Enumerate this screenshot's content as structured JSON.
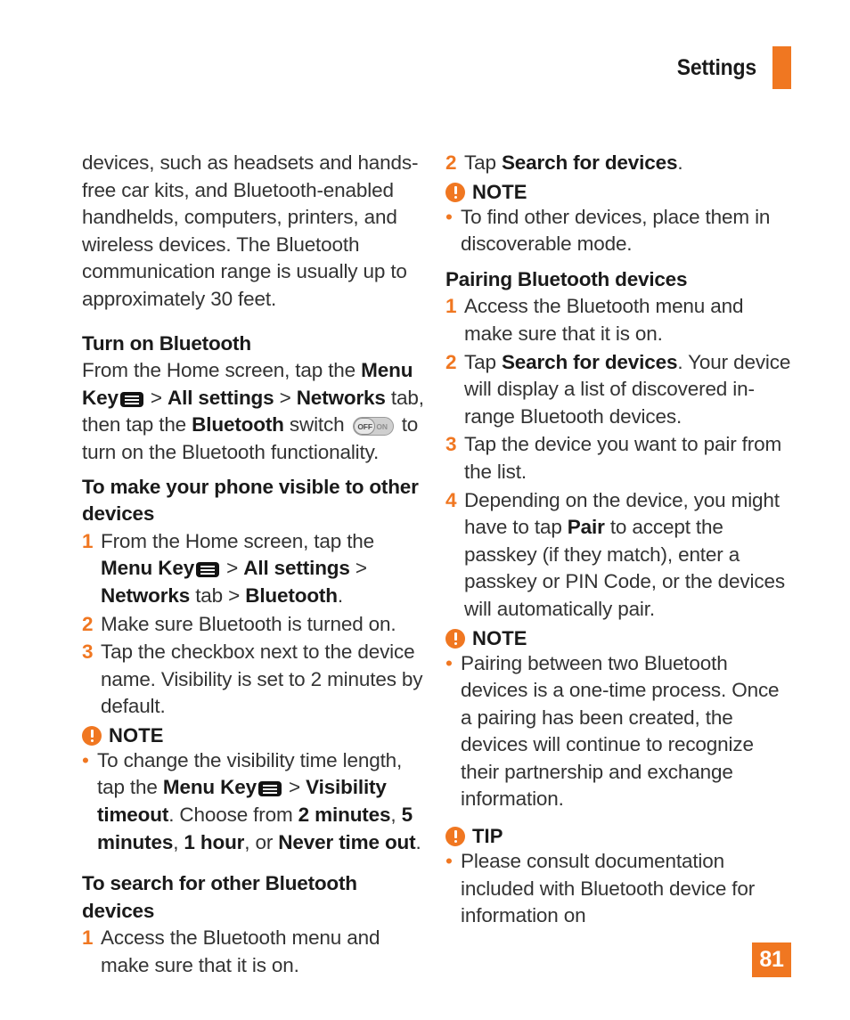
{
  "header": {
    "title": "Settings",
    "accent_color": "#F07721"
  },
  "page_number": "81",
  "icons": {
    "menu_key": "menu-key-icon",
    "toggle_off_label": "OFF",
    "toggle_on_label": "ON",
    "note_icon": "exclamation-circle-icon"
  },
  "left_column": {
    "intro_paragraph": "devices, such as headsets and hands-free car kits, and Bluetooth-enabled handhelds, computers, printers, and wireless devices. The Bluetooth communication range is usually up to approximately 30 feet.",
    "section_turn_on": {
      "heading": "Turn on Bluetooth",
      "body_1": "From the Home screen, tap the ",
      "bold_1": "Menu Key",
      "sep_1": " > ",
      "bold_2": "All settings",
      "sep_2": " > ",
      "bold_3": "Networks",
      "body_2": " tab, then tap the ",
      "bold_4": "Bluetooth",
      "body_3": " switch ",
      "body_4": " to turn on the Bluetooth functionality."
    },
    "section_visible": {
      "heading": "To make your phone visible to other devices",
      "steps": [
        {
          "num": "1",
          "t1": "From the Home screen, tap the ",
          "b1": "Menu Key",
          "s1": " > ",
          "b2": "All settings",
          "s2": " > ",
          "b3": "Networks",
          "t2": " tab > ",
          "b4": "Bluetooth",
          "t3": "."
        },
        {
          "num": "2",
          "text": "Make sure Bluetooth is turned on."
        },
        {
          "num": "3",
          "text": "Tap the checkbox next to the device name. Visibility is set to 2 minutes by default."
        }
      ],
      "note": {
        "label": "NOTE",
        "bullet": {
          "t1": "To change the visibility time length, tap the ",
          "b1": "Menu Key",
          "s1": " > ",
          "b2": "Visibility timeout",
          "t2": ". Choose from ",
          "b3": "2 minutes",
          "t3": ", ",
          "b4": "5 minutes",
          "t4": ", ",
          "b5": "1 hour",
          "t5": ", or ",
          "b6": "Never time out",
          "t6": "."
        }
      }
    },
    "section_search": {
      "heading": "To search for other Bluetooth devices",
      "steps": [
        {
          "num": "1",
          "text": "Access the Bluetooth menu and make sure that it is on."
        }
      ]
    }
  },
  "right_column": {
    "search_continued": {
      "steps": [
        {
          "num": "2",
          "t1": "Tap ",
          "b1": "Search for devices",
          "t2": "."
        }
      ],
      "note": {
        "label": "NOTE",
        "bullets": [
          "To find other devices, place them in discoverable mode."
        ]
      }
    },
    "section_pairing": {
      "heading": "Pairing Bluetooth devices",
      "steps": [
        {
          "num": "1",
          "text": "Access the Bluetooth menu and make sure that it is on."
        },
        {
          "num": "2",
          "t1": "Tap ",
          "b1": "Search for devices",
          "t2": ". Your device will display a list of discovered in-range Bluetooth devices."
        },
        {
          "num": "3",
          "text": "Tap the device you want to pair from the list."
        },
        {
          "num": "4",
          "t1": "Depending on the device, you might have to tap ",
          "b1": "Pair",
          "t2": " to accept the passkey (if they match), enter a passkey or PIN Code, or the devices will automatically pair."
        }
      ],
      "note": {
        "label": "NOTE",
        "bullets": [
          "Pairing between two Bluetooth devices is a one-time process. Once a pairing has been created, the devices will continue to recognize their partnership and exchange information."
        ]
      },
      "tip": {
        "label": "TIP",
        "bullets": [
          "Please consult documentation included with Bluetooth device for information on"
        ]
      }
    }
  }
}
